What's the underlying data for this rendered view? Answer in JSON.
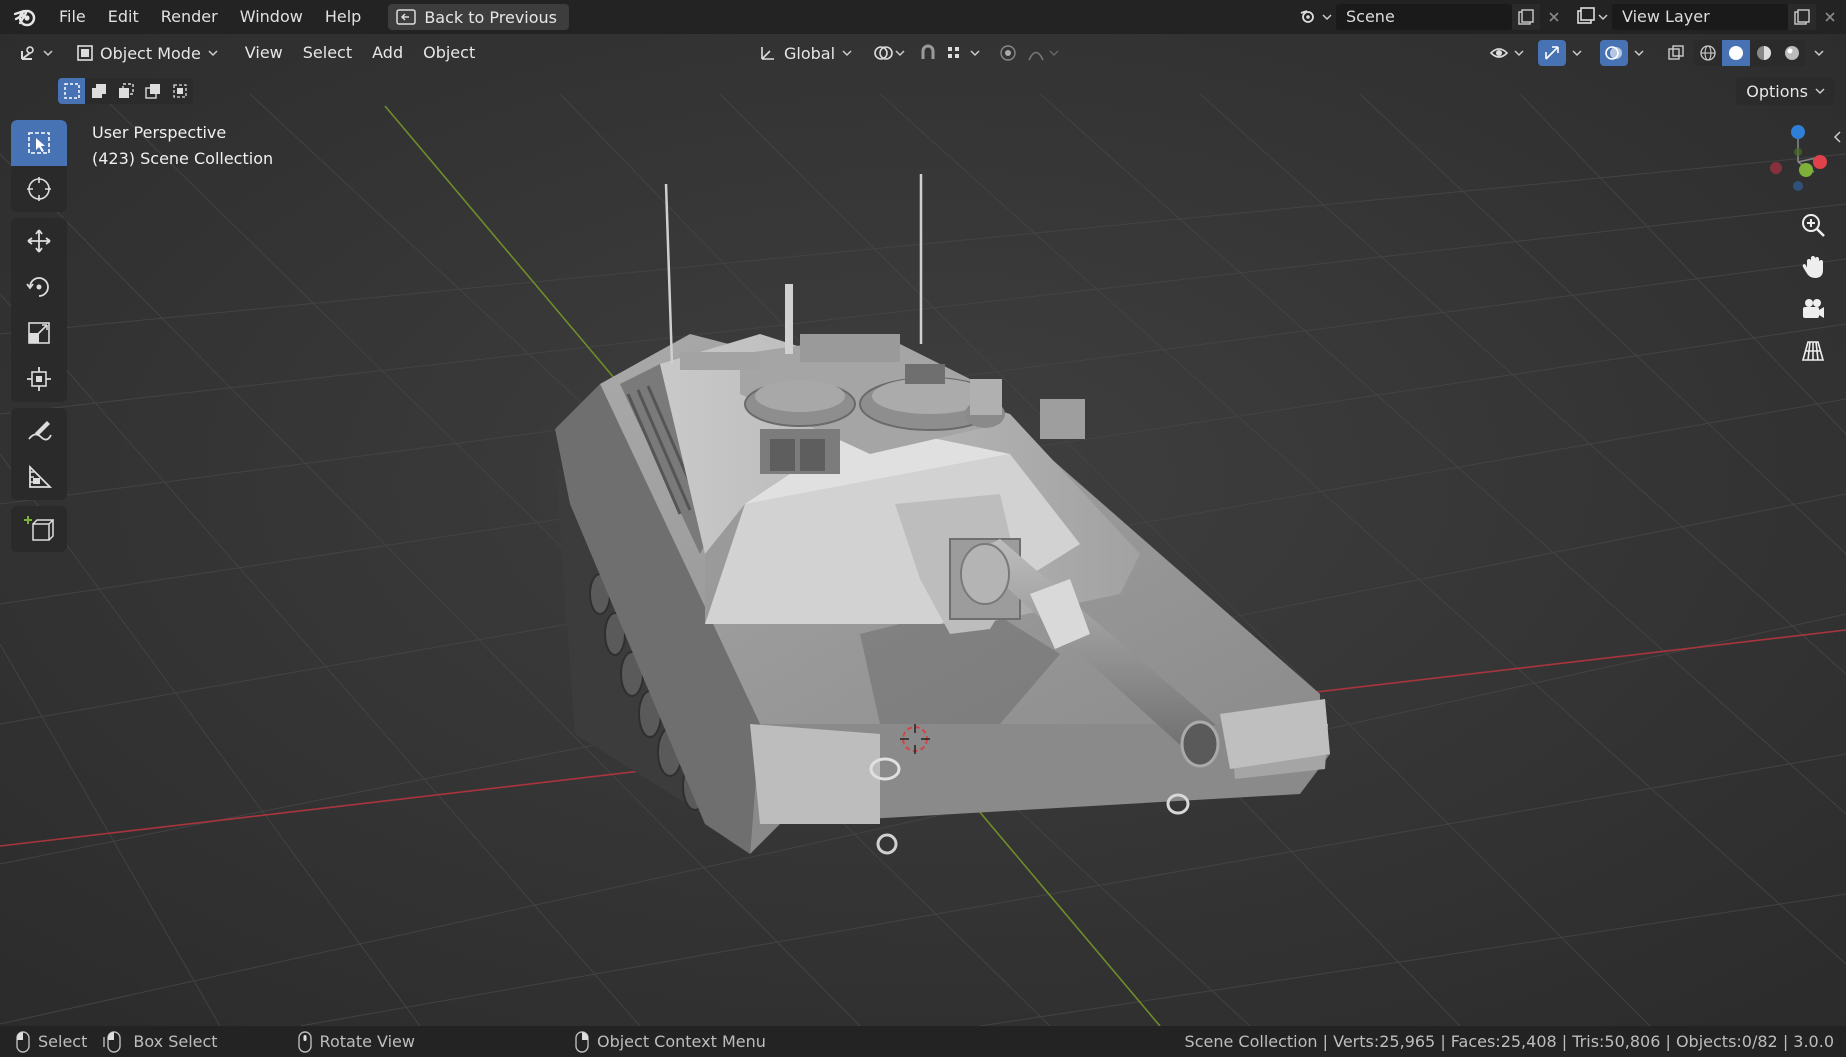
{
  "app": {
    "name": "Blender"
  },
  "topbar": {
    "menus": [
      "File",
      "Edit",
      "Render",
      "Window",
      "Help"
    ],
    "back_button": "Back to Previous",
    "scene_label": "Scene",
    "view_layer_label": "View Layer"
  },
  "header": {
    "mode": "Object Mode",
    "menus": [
      "View",
      "Select",
      "Add",
      "Object"
    ],
    "transform_orientation": "Global",
    "options": "Options"
  },
  "viewport": {
    "view_name": "User Perspective",
    "collection_info": "(423) Scene Collection"
  },
  "tools": [
    "select-box-tool",
    "cursor-tool",
    "move-tool",
    "rotate-tool",
    "scale-tool",
    "transform-tool",
    "annotate-tool",
    "measure-tool",
    "add-cube-tool"
  ],
  "statusbar": {
    "select": "Select",
    "box_select": "Box Select",
    "rotate_view": "Rotate View",
    "context_menu": "Object Context Menu",
    "stats": "Scene Collection | Verts:25,965 | Faces:25,408 | Tris:50,806 | Objects:0/82 | 3.0.0"
  },
  "colors": {
    "accent": "#4772b3",
    "axis_x": "#a8353e",
    "axis_y": "#6e8d2a",
    "gizmo_z": "#2f7fd6",
    "gizmo_y": "#7fb13a",
    "gizmo_x": "#e0424c"
  }
}
